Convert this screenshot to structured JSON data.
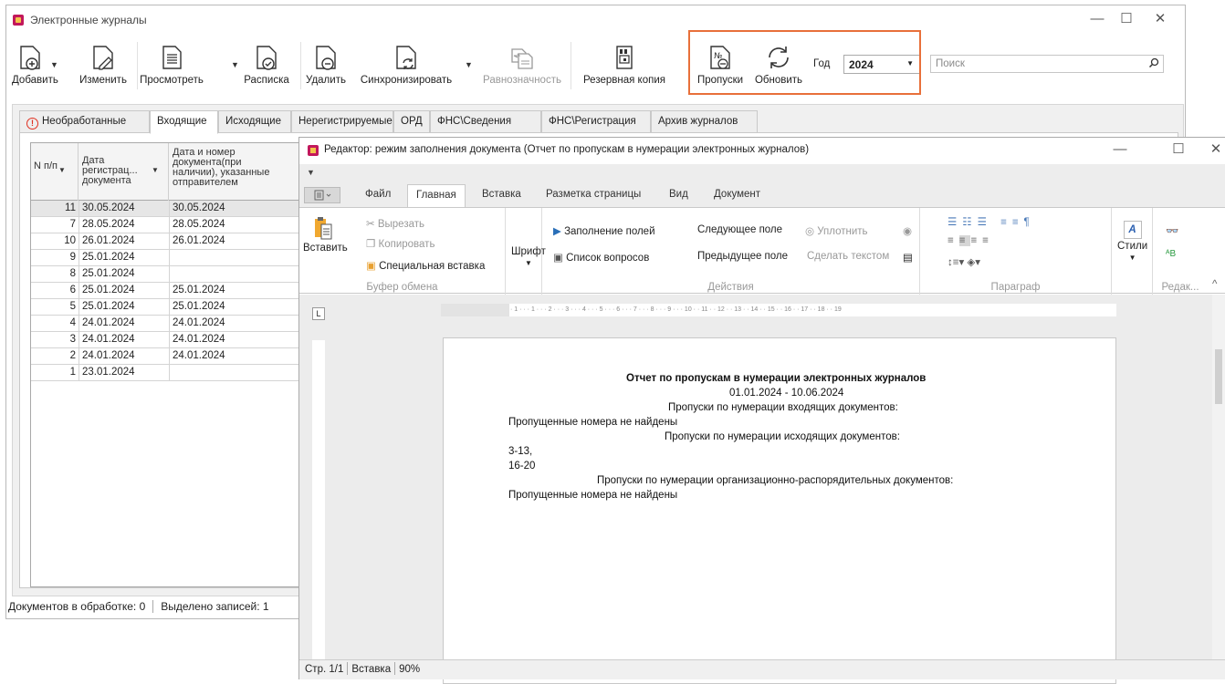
{
  "main": {
    "title": "Электронные журналы",
    "toolbar": {
      "add": "Добавить",
      "edit": "Изменить",
      "view": "Просмотреть",
      "receipt": "Расписка",
      "delete": "Удалить",
      "sync": "Синхронизировать",
      "equivalence": "Равнозначность",
      "backup": "Резервная копия",
      "gaps": "Пропуски",
      "refresh": "Обновить",
      "year_label": "Год",
      "year_value": "2024",
      "search_placeholder": "Поиск"
    },
    "tabs": [
      "Необработанные",
      "Входящие",
      "Исходящие",
      "Нерегистрируемые",
      "ОРД",
      "ФНС\\Сведения",
      "ФНС\\Регистрация",
      "Архив журналов"
    ],
    "active_tab": "Входящие",
    "grid": {
      "columns": [
        "N п/п",
        "Дата регистрац... документа",
        "Дата и номер документа(при наличии), указанные отправителем"
      ],
      "rows": [
        {
          "n": "11",
          "reg_date": "30.05.2024",
          "sender": "30.05.2024"
        },
        {
          "n": "7",
          "reg_date": "28.05.2024",
          "sender": "28.05.2024"
        },
        {
          "n": "10",
          "reg_date": "26.01.2024",
          "sender": "26.01.2024"
        },
        {
          "n": "9",
          "reg_date": "25.01.2024",
          "sender": ""
        },
        {
          "n": "8",
          "reg_date": "25.01.2024",
          "sender": ""
        },
        {
          "n": "6",
          "reg_date": "25.01.2024",
          "sender": "25.01.2024"
        },
        {
          "n": "5",
          "reg_date": "25.01.2024",
          "sender": "25.01.2024"
        },
        {
          "n": "4",
          "reg_date": "24.01.2024",
          "sender": "24.01.2024"
        },
        {
          "n": "3",
          "reg_date": "24.01.2024",
          "sender": "24.01.2024"
        },
        {
          "n": "2",
          "reg_date": "24.01.2024",
          "sender": "24.01.2024"
        },
        {
          "n": "1",
          "reg_date": "23.01.2024",
          "sender": ""
        }
      ]
    },
    "status": {
      "in_processing": "Документов в обработке: 0",
      "selected": "Выделено записей: 1"
    }
  },
  "editor": {
    "title": "Редактор: режим заполнения документа (Отчет по пропускам в нумерации электронных журналов)",
    "ribbon_tabs": [
      "Файл",
      "Главная",
      "Вставка",
      "Разметка страницы",
      "Вид",
      "Документ"
    ],
    "active_ribbon_tab": "Главная",
    "clipboard": {
      "paste": "Вставить",
      "cut": "Вырезать",
      "copy": "Копировать",
      "paste_special": "Специальная вставка",
      "group": "Буфер обмена"
    },
    "font": {
      "label": "Шрифт"
    },
    "actions": {
      "fill_fields": "Заполнение полей",
      "next_field": "Следующее поле",
      "compact": "Уплотнить",
      "question_list": "Список вопросов",
      "prev_field": "Предыдущее поле",
      "make_text": "Сделать текстом",
      "group": "Действия"
    },
    "paragraph": {
      "group": "Параграф"
    },
    "styles": {
      "label": "Стили"
    },
    "editing": {
      "group": "Редак..."
    },
    "document": {
      "title": "Отчет по пропускам в нумерации электронных журналов",
      "period": "01.01.2024 - 10.06.2024",
      "incoming_header": "Пропуски по нумерации входящих документов:",
      "incoming_result": "Пропущенные номера не найдены",
      "outgoing_header": "Пропуски по нумерации исходящих документов:",
      "outgoing_lines": [
        "3-13,",
        "16-20"
      ],
      "ord_header": "Пропуски по нумерации организационно-распорядительных документов:",
      "ord_result": "Пропущенные номера не найдены"
    },
    "status": {
      "page": "Стр. 1/1",
      "mode": "Вставка",
      "zoom": "90%"
    }
  }
}
